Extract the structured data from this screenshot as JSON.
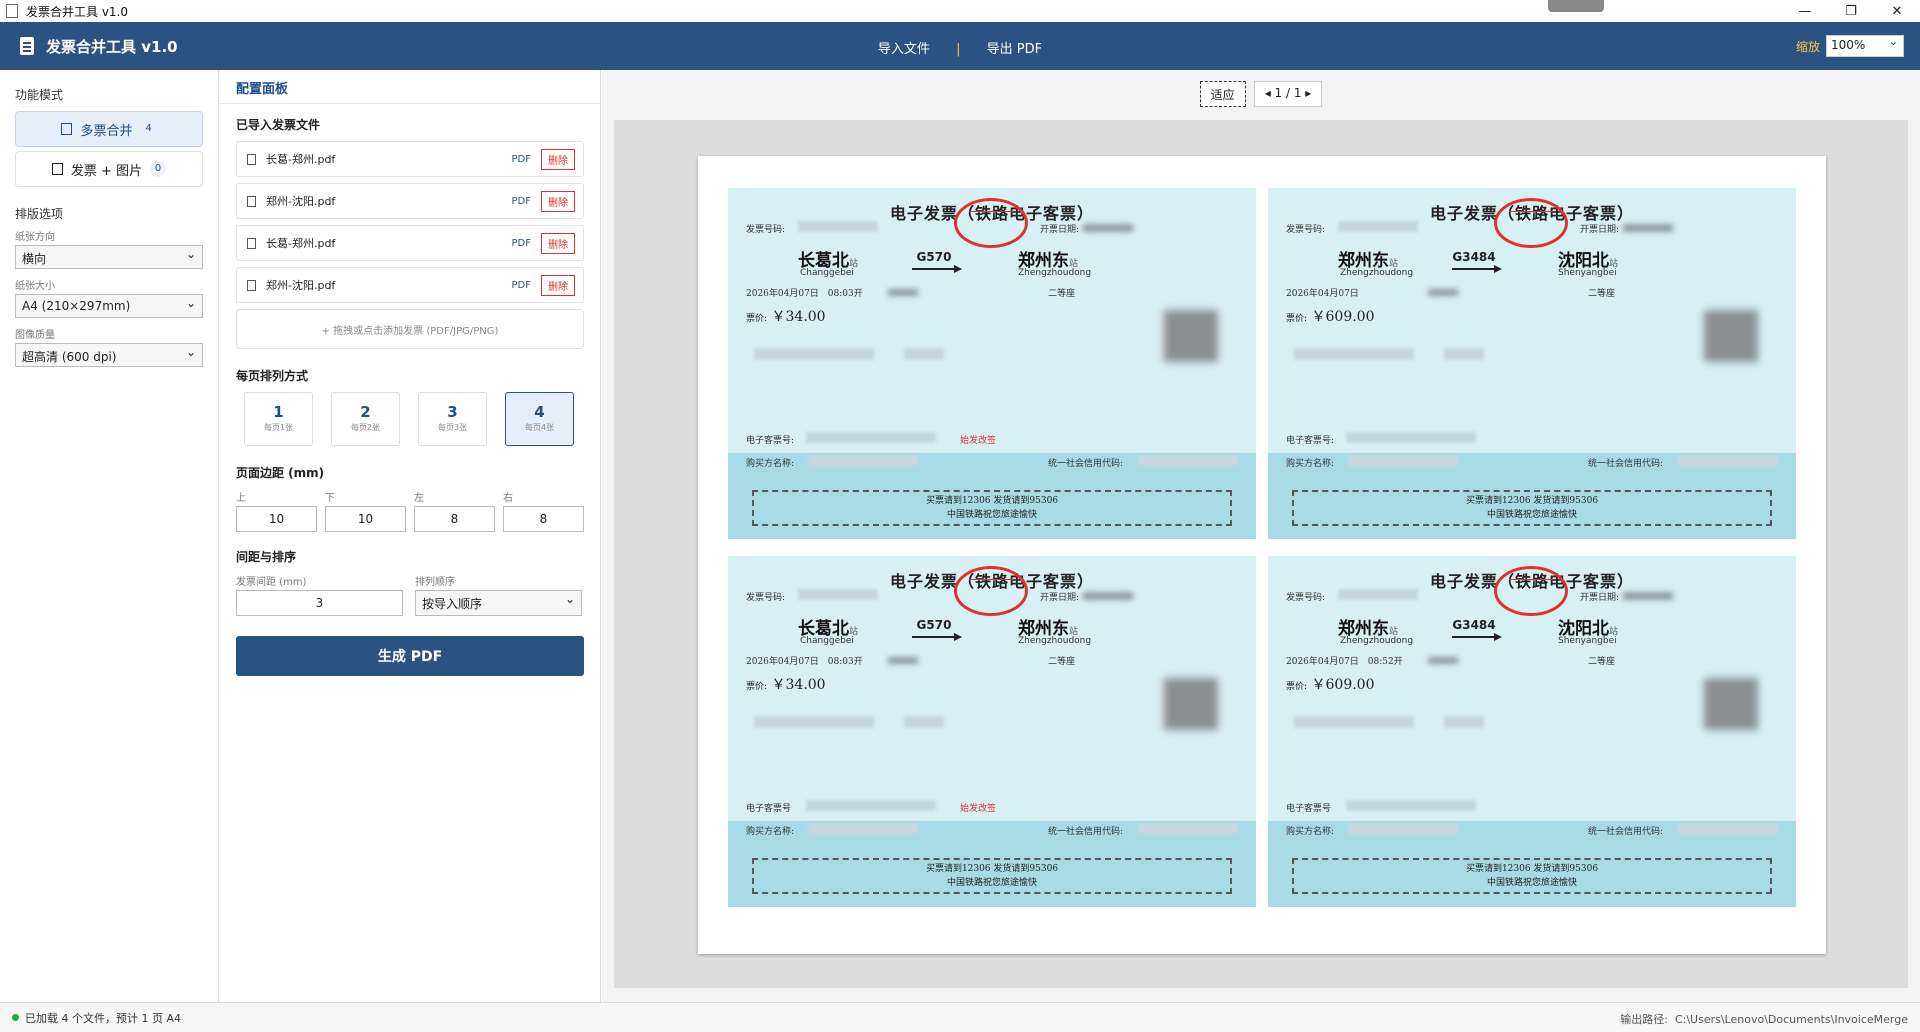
{
  "window": {
    "title": "发票合并工具 v1.0"
  },
  "header": {
    "app_name": "发票合并工具 v1.0",
    "nav": {
      "import": "导入文件",
      "sep": "|",
      "export": "导出 PDF"
    },
    "zoom_label": "缩放",
    "zoom_value": "100%"
  },
  "left": {
    "mode_title": "功能模式",
    "modes": [
      {
        "label": "多票合并",
        "count": "4"
      },
      {
        "label": "发票 + 图片",
        "count": "0"
      }
    ],
    "layout_title": "排版选项",
    "orientation_label": "纸张方向",
    "orientation_value": "横向",
    "paper_label": "纸张大小",
    "paper_value": "A4 (210×297mm)",
    "quality_label": "图像质量",
    "quality_value": "超高清 (600 dpi)"
  },
  "panel": {
    "title": "配置面板",
    "files_title": "已导入发票文件",
    "files": [
      {
        "name": "长葛-郑州.pdf",
        "type": "PDF",
        "del": "删除"
      },
      {
        "name": "郑州-沈阳.pdf",
        "type": "PDF",
        "del": "删除"
      },
      {
        "name": "长葛-郑州.pdf",
        "type": "PDF",
        "del": "删除"
      },
      {
        "name": "郑州-沈阳.pdf",
        "type": "PDF",
        "del": "删除"
      }
    ],
    "drop_hint": "+ 拖拽或点击添加发票 (PDF/JPG/PNG)",
    "per_page_title": "每页排列方式",
    "per_page": [
      {
        "n": "1",
        "s": "每页1张"
      },
      {
        "n": "2",
        "s": "每页2张"
      },
      {
        "n": "3",
        "s": "每页3张"
      },
      {
        "n": "4",
        "s": "每页4张"
      }
    ],
    "margin_title": "页面边距 (mm)",
    "margins": [
      {
        "label": "上",
        "value": "10"
      },
      {
        "label": "下",
        "value": "10"
      },
      {
        "label": "左",
        "value": "8"
      },
      {
        "label": "右",
        "value": "8"
      }
    ],
    "spacing_title": "间距与排序",
    "gap_label": "发票间距 (mm)",
    "gap_value": "3",
    "order_label": "排列顺序",
    "order_value": "按导入顺序",
    "generate": "生成 PDF"
  },
  "preview": {
    "fit": "适应",
    "pager": "◂ 1 / 1 ▸",
    "tickets": [
      {
        "title": "电子发票（铁路电子客票）",
        "invoice_no_label": "发票号码:",
        "date_label": "开票日期:",
        "from": "长葛北",
        "from_py": "Changgebei",
        "train": "G570",
        "to": "郑州东",
        "to_py": "Zhengzhoudong",
        "depart": "2026年04月07日　08:03开",
        "seat": "二等座",
        "price_label": "票价:",
        "price": "￥34.00",
        "eticket_label": "电子客票号:",
        "change": "始发改签",
        "buyer_label": "购买方名称:",
        "credit_label": "统一社会信用代码:",
        "notice1": "买票请到12306 发货请到95306",
        "notice2": "中国铁路祝您旅途愉快"
      },
      {
        "title": "电子发票（铁路电子客票）",
        "invoice_no_label": "发票号码:",
        "date_label": "开票日期:",
        "from": "郑州东",
        "from_py": "Zhengzhoudong",
        "train": "G3484",
        "to": "沈阳北",
        "to_py": "Shenyangbei",
        "depart": "2026年04月07日",
        "seat": "二等座",
        "price_label": "票价:",
        "price": "￥609.00",
        "eticket_label": "电子客票号:",
        "change": "",
        "buyer_label": "购买方名称:",
        "credit_label": "统一社会信用代码:",
        "notice1": "买票请到12306 发货请到95306",
        "notice2": "中国铁路祝您旅途愉快"
      },
      {
        "title": "电子发票（铁路电子客票）",
        "invoice_no_label": "发票号码:",
        "date_label": "开票日期:",
        "from": "长葛北",
        "from_py": "Changgebei",
        "train": "G570",
        "to": "郑州东",
        "to_py": "Zhengzhoudong",
        "depart": "2026年04月07日　08:03开",
        "seat": "二等座",
        "price_label": "票价:",
        "price": "￥34.00",
        "eticket_label": "电子客票号",
        "change": "始发改签",
        "buyer_label": "购买方名称:",
        "credit_label": "统一社会信用代码:",
        "notice1": "买票请到12306 发货请到95306",
        "notice2": "中国铁路祝您旅途愉快"
      },
      {
        "title": "电子发票（铁路电子客票）",
        "invoice_no_label": "发票号码:",
        "date_label": "开票日期:",
        "from": "郑州东",
        "from_py": "Zhengzhoudong",
        "train": "G3484",
        "to": "沈阳北",
        "to_py": "Shenyangbei",
        "depart": "2026年04月07日　08:52开",
        "seat": "二等座",
        "price_label": "票价:",
        "price": "￥609.00",
        "eticket_label": "电子客票号",
        "change": "",
        "buyer_label": "购买方名称:",
        "credit_label": "统一社会信用代码:",
        "notice1": "买票请到12306 发货请到95306",
        "notice2": "中国铁路祝您旅途愉快"
      }
    ]
  },
  "status": {
    "message": "已加载 4 个文件，预计 1 页 A4",
    "path_label": "输出路径:",
    "path": "C:\\Users\\Lenovo\\Documents\\InvoiceMerge"
  },
  "colors": {
    "header": "#2c5282",
    "accent": "#f6c744",
    "danger": "#e03030",
    "ticket_bg": "#d7f0f4",
    "ticket_band": "#a8dae5"
  }
}
